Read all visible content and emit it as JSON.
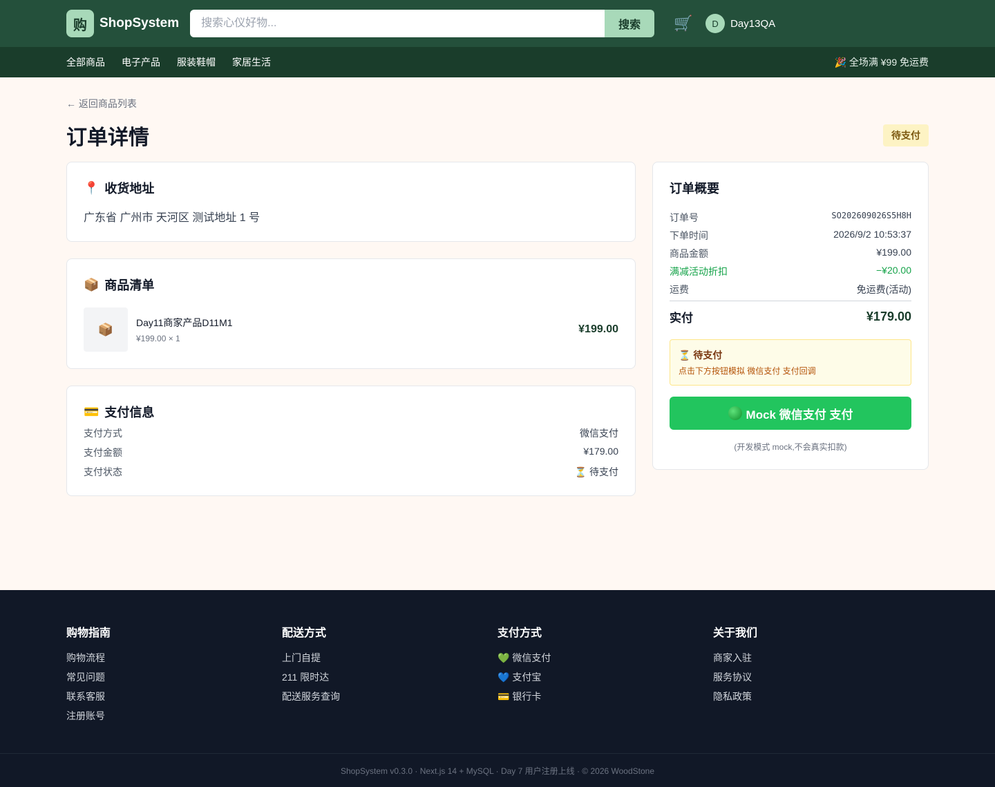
{
  "header": {
    "logo_char": "购",
    "logo_text": "ShopSystem",
    "search_placeholder": "搜索心仪好物...",
    "search_button": "搜索",
    "cart_icon": "🛒",
    "avatar_initial": "D",
    "username": "Day13QA"
  },
  "nav": {
    "items": [
      "全部商品",
      "电子产品",
      "服装鞋帽",
      "家居生活"
    ],
    "promo": "🎉 全场满 ¥99 免运费"
  },
  "page": {
    "back_link": "← 返回商品列表",
    "title": "订单详情",
    "status": "待支付"
  },
  "address_card": {
    "icon": "📍",
    "title": "收货地址",
    "address": "广东省 广州市 天河区 测试地址 1 号"
  },
  "items_card": {
    "icon": "📦",
    "title": "商品清单",
    "items": [
      {
        "thumb": "📦",
        "name": "Day11商家产品D11M1",
        "meta": "¥199.00 × 1",
        "price": "¥199.00"
      }
    ]
  },
  "payment_card": {
    "icon": "💳",
    "title": "支付信息",
    "rows": [
      {
        "label": "支付方式",
        "value": "微信支付"
      },
      {
        "label": "支付金额",
        "value": "¥179.00"
      },
      {
        "label": "支付状态",
        "value": "⏳ 待支付"
      }
    ]
  },
  "summary": {
    "title": "订单概要",
    "order_no_label": "订单号",
    "order_no": "SO202609026S5H8H",
    "time_label": "下单时间",
    "time": "2026/9/2 10:53:37",
    "amount_label": "商品金额",
    "amount": "¥199.00",
    "discount_label": "满减活动折扣",
    "discount": "−¥20.00",
    "shipping_label": "运费",
    "shipping": "免运费(活动)",
    "total_label": "实付",
    "total": "¥179.00",
    "pending_title": "⏳ 待支付",
    "pending_desc": "点击下方按钮模拟 微信支付 支付回调",
    "pay_button": "Mock 微信支付 支付",
    "note": "(开发模式 mock,不会真实扣款)"
  },
  "footer": {
    "columns": [
      {
        "title": "购物指南",
        "links": [
          "购物流程",
          "常见问题",
          "联系客服",
          "注册账号"
        ]
      },
      {
        "title": "配送方式",
        "links": [
          "上门自提",
          "211 限时达",
          "配送服务查询"
        ]
      },
      {
        "title": "支付方式",
        "links": [
          "💚 微信支付",
          "💙 支付宝",
          "💳 银行卡"
        ]
      },
      {
        "title": "关于我们",
        "links": [
          "商家入驻",
          "服务协议",
          "隐私政策"
        ]
      }
    ],
    "copyright": "ShopSystem v0.3.0 · Next.js 14 + MySQL · Day 7 用户注册上线 · © 2026 WoodStone"
  },
  "colors": {
    "header_bg": "#24503b",
    "nav_bg": "#1a3d2b",
    "page_bg": "#fff8f3",
    "accent_green": "#22c55e",
    "pending_bg": "#fdf3c4",
    "footer_bg": "#111827"
  }
}
